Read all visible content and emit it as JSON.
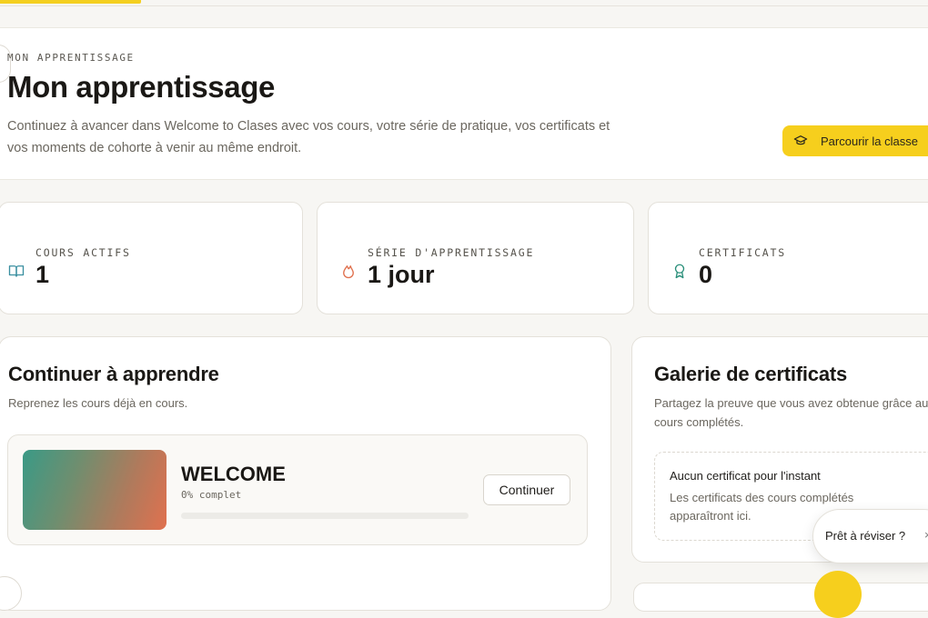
{
  "hero": {
    "eyebrow": "MON APPRENTISSAGE",
    "title": "Mon apprentissage",
    "description": "Continuez à avancer dans Welcome to Clases avec vos cours, votre série de pratique, vos certificats et vos moments de cohorte à venir au même endroit.",
    "browse_button": "Parcourir la classe",
    "browse_icon": "graduation-cap-icon"
  },
  "stats": [
    {
      "label": "COURS ACTIFS",
      "value": "1",
      "icon": "book-open-icon",
      "icon_color": "#3a8fa0"
    },
    {
      "label": "SÉRIE D'APPRENTISSAGE",
      "value": "1 jour",
      "icon": "flame-icon",
      "icon_color": "#e0714f"
    },
    {
      "label": "CERTIFICATS",
      "value": "0",
      "icon": "award-icon",
      "icon_color": "#2a8f7a"
    }
  ],
  "continue_learning": {
    "title": "Continuer à apprendre",
    "subtitle": "Reprenez les cours déjà en cours.",
    "course": {
      "title": "WELCOME",
      "progress_text": "0% complet",
      "progress": 0,
      "button": "Continuer"
    }
  },
  "certificates": {
    "title": "Galerie de certificats",
    "subtitle": "Partagez la preuve que vous avez obtenue grâce aux cours complétés.",
    "empty_title": "Aucun certificat pour l'instant",
    "empty_desc": "Les certificats des cours complétés apparaîtront ici."
  },
  "review_prompt": {
    "text": "Prêt à réviser ?",
    "close": "×"
  },
  "colors": {
    "accent": "#f4cf1f",
    "background": "#f7f6f3"
  }
}
